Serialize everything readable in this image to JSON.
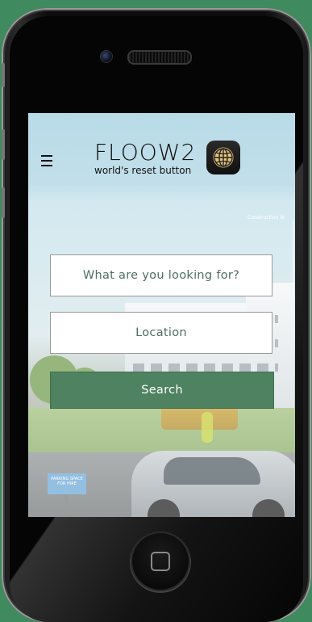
{
  "colors": {
    "page_background": "#3f8a5e",
    "search_button": "#4e8260",
    "field_text": "#4f6d66"
  },
  "header": {
    "menu_icon": "hamburger-menu-icon",
    "logo_wordmark": "FLOOW2",
    "logo_tagline": "world's reset button",
    "logo_icon": "globe-icon"
  },
  "background_illustration": {
    "label": "Construction W",
    "sign_text": "PARKING SPACE FOR HIRE"
  },
  "search": {
    "what_placeholder": "What are you looking for?",
    "location_placeholder": "Location",
    "button_label": "Search"
  },
  "device": {
    "home_button_icon": "home-square-icon"
  }
}
